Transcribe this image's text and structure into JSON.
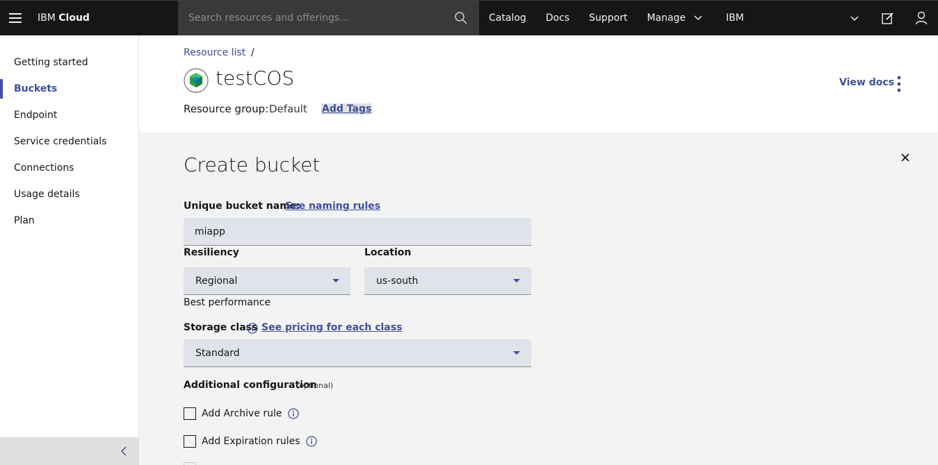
{
  "topbar": {
    "brand_prefix": "IBM",
    "brand_bold": "Cloud",
    "search_placeholder": "Search resources and offerings...",
    "nav": [
      "Catalog",
      "Docs",
      "Support",
      "Manage",
      "IBM"
    ]
  },
  "sidebar": {
    "items": [
      {
        "label": "Getting started"
      },
      {
        "label": "Buckets"
      },
      {
        "label": "Endpoint"
      },
      {
        "label": "Service credentials"
      },
      {
        "label": "Connections"
      },
      {
        "label": "Usage details"
      },
      {
        "label": "Plan"
      }
    ],
    "active_index": 1
  },
  "header": {
    "breadcrumb": "Resource list",
    "breadcrumb_sep": "/",
    "title": "testCOS",
    "resource_group_label": "Resource group:",
    "resource_group_value": "Default",
    "add_tags": "Add Tags",
    "view_docs": "View docs"
  },
  "form": {
    "title": "Create bucket",
    "bucket_name_label": "Unique bucket name:",
    "naming_rules_link": "See naming rules",
    "bucket_name_value": "miapp",
    "resiliency_label": "Resiliency",
    "resiliency_value": "Regional",
    "resiliency_helper": "Best performance",
    "location_label": "Location",
    "location_value": "us-south",
    "storage_class_label": "Storage class",
    "pricing_link": "See pricing for each class",
    "storage_class_value": "Standard",
    "additional_label": "Additional configuration",
    "optional_text": "(optional)",
    "archive_rule": "Add Archive rule",
    "expiration_rules": "Add Expiration rules"
  },
  "colors": {
    "topbar_bg": "#161616",
    "accent": "#3d4f9f",
    "panel_bg": "#f3f3f3",
    "field_bg": "#e0e3ea"
  },
  "icons": [
    "hamburger-icon",
    "search-icon",
    "chevron-down-icon",
    "edit-icon",
    "user-icon",
    "cos-logo-icon",
    "overflow-menu-icon",
    "close-icon",
    "info-icon",
    "chevron-left-icon"
  ]
}
